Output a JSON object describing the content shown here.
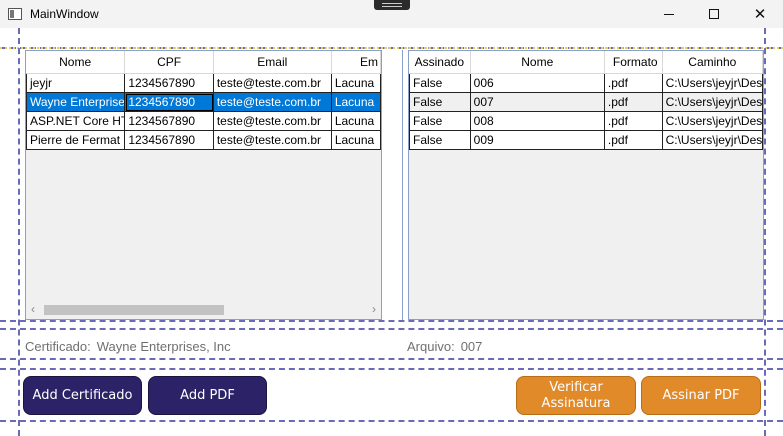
{
  "window": {
    "title": "MainWindow"
  },
  "left_grid": {
    "columns": [
      "Nome",
      "CPF",
      "Email",
      "Em"
    ],
    "rows": [
      [
        "jeyjr",
        "1234567890",
        "teste@teste.com.br",
        "Lacuna"
      ],
      [
        "Wayne Enterprises",
        "1234567890",
        "teste@teste.com.br",
        "Lacuna"
      ],
      [
        "ASP.NET Core HT",
        "1234567890",
        "teste@teste.com.br",
        "Lacuna"
      ],
      [
        "Pierre de Fermat",
        "1234567890",
        "teste@teste.com.br",
        "Lacuna"
      ]
    ],
    "selected_row": 1
  },
  "right_grid": {
    "columns": [
      "Assinado",
      "Nome",
      "Formato",
      "Caminho"
    ],
    "rows": [
      [
        "False",
        "006",
        ".pdf",
        "C:\\Users\\jeyjr\\Des"
      ],
      [
        "False",
        "007",
        ".pdf",
        "C:\\Users\\jeyjr\\Des"
      ],
      [
        "False",
        "008",
        ".pdf",
        "C:\\Users\\jeyjr\\Des"
      ],
      [
        "False",
        "009",
        ".pdf",
        "C:\\Users\\jeyjr\\Des"
      ]
    ]
  },
  "info": {
    "cert_label": "Certificado:",
    "cert_value": "Wayne Enterprises, Inc",
    "file_label": "Arquivo:",
    "file_value": "007"
  },
  "buttons": {
    "add_cert": "Add Certificado",
    "add_pdf": "Add PDF",
    "verify_line1": "Verificar",
    "verify_line2": "Assinatura",
    "sign": "Assinar PDF"
  },
  "colors": {
    "accent_dark": "#2c2268",
    "accent_orange": "#e08a2a",
    "selection": "#0078d7"
  },
  "icons": [
    "app-icon",
    "minimize-icon",
    "maximize-icon",
    "close-icon",
    "scroll-left-icon",
    "scroll-right-icon"
  ]
}
